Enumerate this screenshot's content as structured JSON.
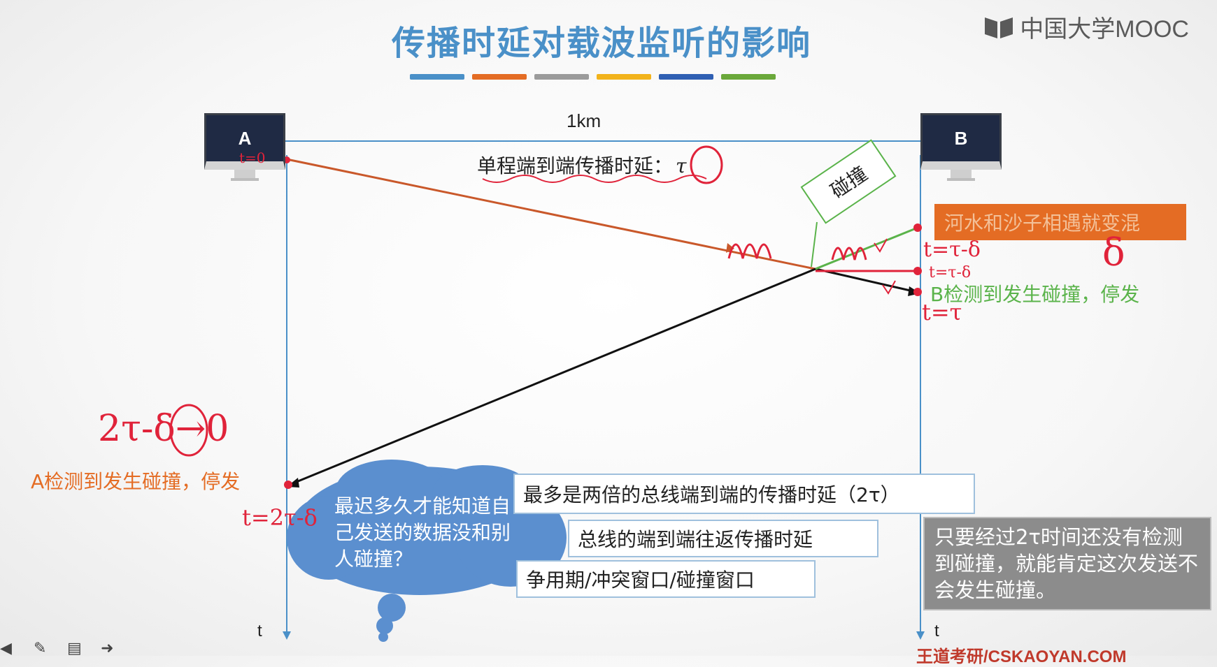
{
  "title": "传播时延对载波监听的影响",
  "logo": {
    "text": "中国大学MOOC",
    "icon": "mooc-book-icon"
  },
  "accent_colors": [
    "#4a90c8",
    "#e46c24",
    "#9b9b9b",
    "#f2b31b",
    "#2f5fb3",
    "#6aa83a"
  ],
  "stations": {
    "a": "A",
    "b": "B"
  },
  "distance": "1km",
  "delay_label": "单程端到端传播时延：",
  "tau": "τ",
  "collision": "碰撞",
  "mix_box": "河水和沙子相遇就变混",
  "b_detect": "B检测到发生碰撞，停发",
  "a_detect": "A检测到发生碰撞，停发",
  "time_axis": {
    "left": "t",
    "right": "t"
  },
  "cloud_question": "最迟多久才能知道自己发送的数据没和别人碰撞？",
  "answers": {
    "max": "最多是两倍的总线端到端的传播时延（2τ）",
    "roundtrip": "总线的端到端往返传播时延",
    "windows": "争用期/冲突窗口/碰撞窗口"
  },
  "note": "只要经过2τ时间还没有检测到碰撞，就能肯定这次发送不会发生碰撞。",
  "footer": "王道考研/CSKAOYAN.COM",
  "handwriting": {
    "t0": "t=0",
    "b_t1": "t=τ-δ",
    "b_t2": "t=τ-δ",
    "delta": "δ",
    "b_t3": "t=τ",
    "a_limit": "2τ-δ→0",
    "a_t": "t=2τ-δ"
  }
}
